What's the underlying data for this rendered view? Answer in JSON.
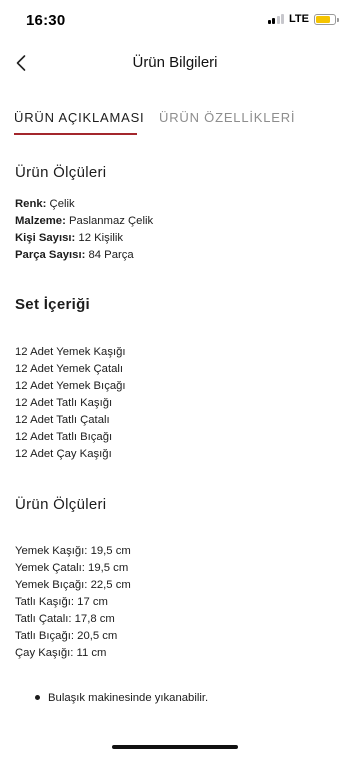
{
  "status_bar": {
    "time": "16:30",
    "network": "LTE",
    "battery_level": 0.75,
    "battery_color": "#f5c400"
  },
  "nav": {
    "title": "Ürün Bilgileri",
    "back_icon": "chevron-left-icon"
  },
  "tabs": [
    {
      "label": "ÜRÜN AÇIKLAMASI",
      "active": true
    },
    {
      "label": "ÜRÜN ÖZELLİKLERİ",
      "active": false
    }
  ],
  "accent_color": "#a3262c",
  "details": {
    "title": "Ürün Ölçüleri",
    "rows": [
      {
        "label": "Renk:",
        "value": " Çelik"
      },
      {
        "label": "Malzeme:",
        "value": " Paslanmaz Çelik"
      },
      {
        "label": "Kişi Sayısı:",
        "value": " 12 Kişilik"
      },
      {
        "label": "Parça Sayısı:",
        "value": " 84 Parça"
      }
    ]
  },
  "set_contents": {
    "title": "Set İçeriği",
    "items": [
      "12 Adet Yemek Kaşığı",
      "12 Adet Yemek Çatalı",
      "12 Adet Yemek Bıçağı",
      "12 Adet Tatlı Kaşığı",
      "12 Adet Tatlı Çatalı",
      "12 Adet Tatlı Bıçağı",
      "12 Adet Çay Kaşığı"
    ]
  },
  "dimensions": {
    "title": "Ürün Ölçüleri",
    "items": [
      "Yemek Kaşığı: 19,5 cm",
      "Yemek Çatalı: 19,5 cm",
      "Yemek Bıçağı: 22,5 cm",
      "Tatlı Kaşığı: 17 cm",
      "Tatlı Çatalı: 17,8 cm",
      "Tatlı Bıçağı: 20,5 cm",
      "Çay Kaşığı: 11 cm"
    ]
  },
  "notes": [
    "Bulaşık makinesinde yıkanabilir."
  ]
}
